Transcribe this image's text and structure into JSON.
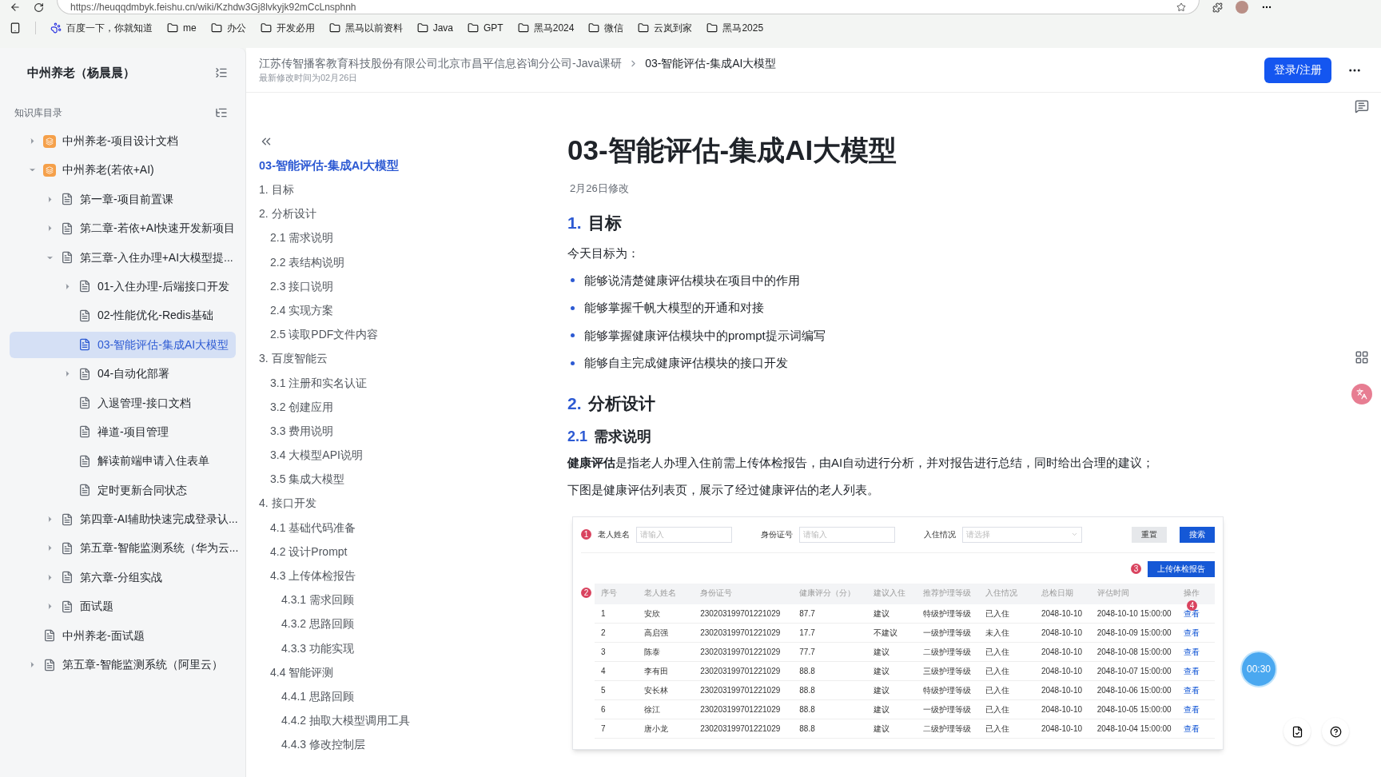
{
  "browser": {
    "url": "https://heuqqdmbyk.feishu.cn/wiki/Kzhdw3Gj8lvkyjk92mCcLnsphnh",
    "bookmarks": [
      {
        "label": "百度一下，你就知道",
        "kind": "site"
      },
      {
        "label": "me",
        "kind": "folder"
      },
      {
        "label": "办公",
        "kind": "folder"
      },
      {
        "label": "开发必用",
        "kind": "folder"
      },
      {
        "label": "黑马以前资料",
        "kind": "folder"
      },
      {
        "label": "Java",
        "kind": "folder"
      },
      {
        "label": "GPT",
        "kind": "folder"
      },
      {
        "label": "黑马2024",
        "kind": "folder"
      },
      {
        "label": "微信",
        "kind": "folder"
      },
      {
        "label": "云岚到家",
        "kind": "folder"
      },
      {
        "label": "黑马2025",
        "kind": "folder"
      }
    ]
  },
  "sidebar": {
    "title": "中州养老（杨晨晨）",
    "section_label": "知识库目录",
    "tree": [
      {
        "label": "中州养老-项目设计文档",
        "kind": "space",
        "expanded": false,
        "selected": false
      },
      {
        "label": "中州养老(若依+AI)",
        "kind": "space",
        "expanded": true,
        "selected": false,
        "children": [
          {
            "label": "第一章-项目前置课",
            "kind": "doc",
            "expanded": false,
            "selected": false
          },
          {
            "label": "第二章-若依+AI快速开发新项目",
            "kind": "doc",
            "expanded": false,
            "selected": false
          },
          {
            "label": "第三章-入住办理+AI大模型提...",
            "kind": "doc",
            "expanded": true,
            "selected": false,
            "children": [
              {
                "label": "01-入住办理-后端接口开发",
                "kind": "doc",
                "expanded": false,
                "selected": false
              },
              {
                "label": "02-性能优化-Redis基础",
                "kind": "doc",
                "selected": false
              },
              {
                "label": "03-智能评估-集成AI大模型",
                "kind": "doc",
                "selected": true
              },
              {
                "label": "04-自动化部署",
                "kind": "doc",
                "expanded": false,
                "selected": false
              },
              {
                "label": "入退管理-接口文档",
                "kind": "doc",
                "selected": false
              },
              {
                "label": "禅道-项目管理",
                "kind": "doc",
                "selected": false
              },
              {
                "label": "解读前端申请入住表单",
                "kind": "doc",
                "selected": false
              },
              {
                "label": "定时更新合同状态",
                "kind": "doc",
                "selected": false
              }
            ]
          },
          {
            "label": "第四章-AI辅助快速完成登录认...",
            "kind": "doc",
            "expanded": false,
            "selected": false
          },
          {
            "label": "第五章-智能监测系统（华为云...",
            "kind": "doc",
            "expanded": false,
            "selected": false
          },
          {
            "label": "第六章-分组实战",
            "kind": "doc",
            "expanded": false,
            "selected": false
          },
          {
            "label": "面试题",
            "kind": "doc",
            "expanded": false,
            "selected": false
          }
        ]
      },
      {
        "label": "中州养老-面试题",
        "kind": "doc",
        "selected": false
      },
      {
        "label": "第五章-智能监测系统（阿里云）",
        "kind": "doc",
        "expanded": false,
        "selected": false
      }
    ]
  },
  "header": {
    "breadcrumb": [
      "江苏传智播客教育科技股份有限公司北京市昌平信息咨询分公司-Java课研",
      "03-智能评估-集成AI大模型"
    ],
    "modified_note": "最新修改时间为02月26日",
    "login_button": "登录/注册"
  },
  "toc": {
    "title": {
      "label": "03-智能评估-集成AI大模型",
      "selected": true
    },
    "items": [
      {
        "label": "1. 目标",
        "selected": false
      },
      {
        "label": "2. 分析设计",
        "selected": false,
        "children": [
          {
            "label": "2.1 需求说明",
            "selected": false
          },
          {
            "label": "2.2 表结构说明",
            "selected": false
          },
          {
            "label": "2.3 接口说明",
            "selected": false
          },
          {
            "label": "2.4 实现方案",
            "selected": false
          },
          {
            "label": "2.5 读取PDF文件内容",
            "selected": false
          }
        ]
      },
      {
        "label": "3. 百度智能云",
        "selected": false,
        "children": [
          {
            "label": "3.1 注册和实名认证",
            "selected": false
          },
          {
            "label": "3.2 创建应用",
            "selected": false
          },
          {
            "label": "3.3 费用说明",
            "selected": false
          },
          {
            "label": "3.4 大模型API说明",
            "selected": false
          },
          {
            "label": "3.5 集成大模型",
            "selected": false
          }
        ]
      },
      {
        "label": "4. 接口开发",
        "selected": false,
        "children": [
          {
            "label": "4.1 基础代码准备",
            "selected": false
          },
          {
            "label": "4.2 设计Prompt",
            "selected": false
          },
          {
            "label": "4.3 上传体检报告",
            "selected": false,
            "children": [
              {
                "label": "4.3.1 需求回顾",
                "selected": false
              },
              {
                "label": "4.3.2 思路回顾",
                "selected": false
              },
              {
                "label": "4.3.3 功能实现",
                "selected": false
              }
            ]
          },
          {
            "label": "4.4 智能评测",
            "selected": false,
            "children": [
              {
                "label": "4.4.1 思路回顾",
                "selected": false
              },
              {
                "label": "4.4.2 抽取大模型调用工具",
                "selected": false
              },
              {
                "label": "4.4.3 修改控制层",
                "selected": false
              }
            ]
          }
        ]
      }
    ]
  },
  "document": {
    "title": "03-智能评估-集成AI大模型",
    "modified": "2月26日修改",
    "blocks": [
      {
        "kind": "h1",
        "number": "1.",
        "text": "目标"
      },
      {
        "kind": "paragraph",
        "text": "今天目标为："
      },
      {
        "kind": "bullet",
        "text": "能够说清楚健康评估模块在项目中的作用"
      },
      {
        "kind": "bullet",
        "text": "能够掌握千帆大模型的开通和对接"
      },
      {
        "kind": "bullet",
        "text": "能够掌握健康评估模块中的prompt提示词编写"
      },
      {
        "kind": "bullet",
        "text": "能够自主完成健康评估模块的接口开发"
      },
      {
        "kind": "h1",
        "number": "2.",
        "text": "分析设计"
      },
      {
        "kind": "h2",
        "number": "2.1",
        "text": "需求说明"
      },
      {
        "kind": "paragraph",
        "text": "**健康评估**是指老人办理入住前需上传体检报告，由AI自动进行分析，并对报告进行总结，同时给出合理的建议；"
      },
      {
        "kind": "paragraph",
        "text": "下图是健康评估列表页，展示了经过健康评估的老人列表。"
      }
    ],
    "figure": {
      "filters": [
        {
          "marker": "1",
          "label": "老人姓名",
          "placeholder": "请输入",
          "kind": "input"
        },
        {
          "label": "身份证号",
          "placeholder": "请输入",
          "kind": "input"
        },
        {
          "label": "入住情况",
          "placeholder": "请选择",
          "kind": "select"
        }
      ],
      "reset_button": "重置",
      "search_button": "搜索",
      "upload_marker": "3",
      "upload_button": "上传体检报告",
      "table_marker": "2",
      "action_marker": "4",
      "columns": [
        "序号",
        "老人姓名",
        "身份证号",
        "健康评分（分）",
        "建议入住",
        "推荐护理等级",
        "入住情况",
        "总检日期",
        "评估时间",
        "操作"
      ],
      "rows": [
        [
          "1",
          "安欣",
          "230203199701221029",
          "87.7",
          "建议",
          "特级护理等级",
          "已入住",
          "2048-10-10",
          "2048-10-10 15:00:00",
          "查看"
        ],
        [
          "2",
          "高启强",
          "230203199701221029",
          "17.7",
          "不建议",
          "一级护理等级",
          "未入住",
          "2048-10-10",
          "2048-10-09 15:00:00",
          "查看"
        ],
        [
          "3",
          "陈泰",
          "230203199701221029",
          "77.7",
          "建议",
          "二级护理等级",
          "已入住",
          "2048-10-10",
          "2048-10-08 15:00:00",
          "查看"
        ],
        [
          "4",
          "李有田",
          "230203199701221029",
          "88.8",
          "建议",
          "三级护理等级",
          "已入住",
          "2048-10-10",
          "2048-10-07 15:00:00",
          "查看"
        ],
        [
          "5",
          "安长林",
          "230203199701221029",
          "88.8",
          "建议",
          "特级护理等级",
          "已入住",
          "2048-10-10",
          "2048-10-06 15:00:00",
          "查看"
        ],
        [
          "6",
          "徐江",
          "230203199701221029",
          "88.8",
          "建议",
          "一级护理等级",
          "已入住",
          "2048-10-10",
          "2048-10-05 15:00:00",
          "查看"
        ],
        [
          "7",
          "唐小龙",
          "230203199701221029",
          "88.8",
          "建议",
          "二级护理等级",
          "已入住",
          "2048-10-10",
          "2048-10-04 15:00:00",
          "查看"
        ]
      ]
    }
  },
  "timer": "00:30"
}
